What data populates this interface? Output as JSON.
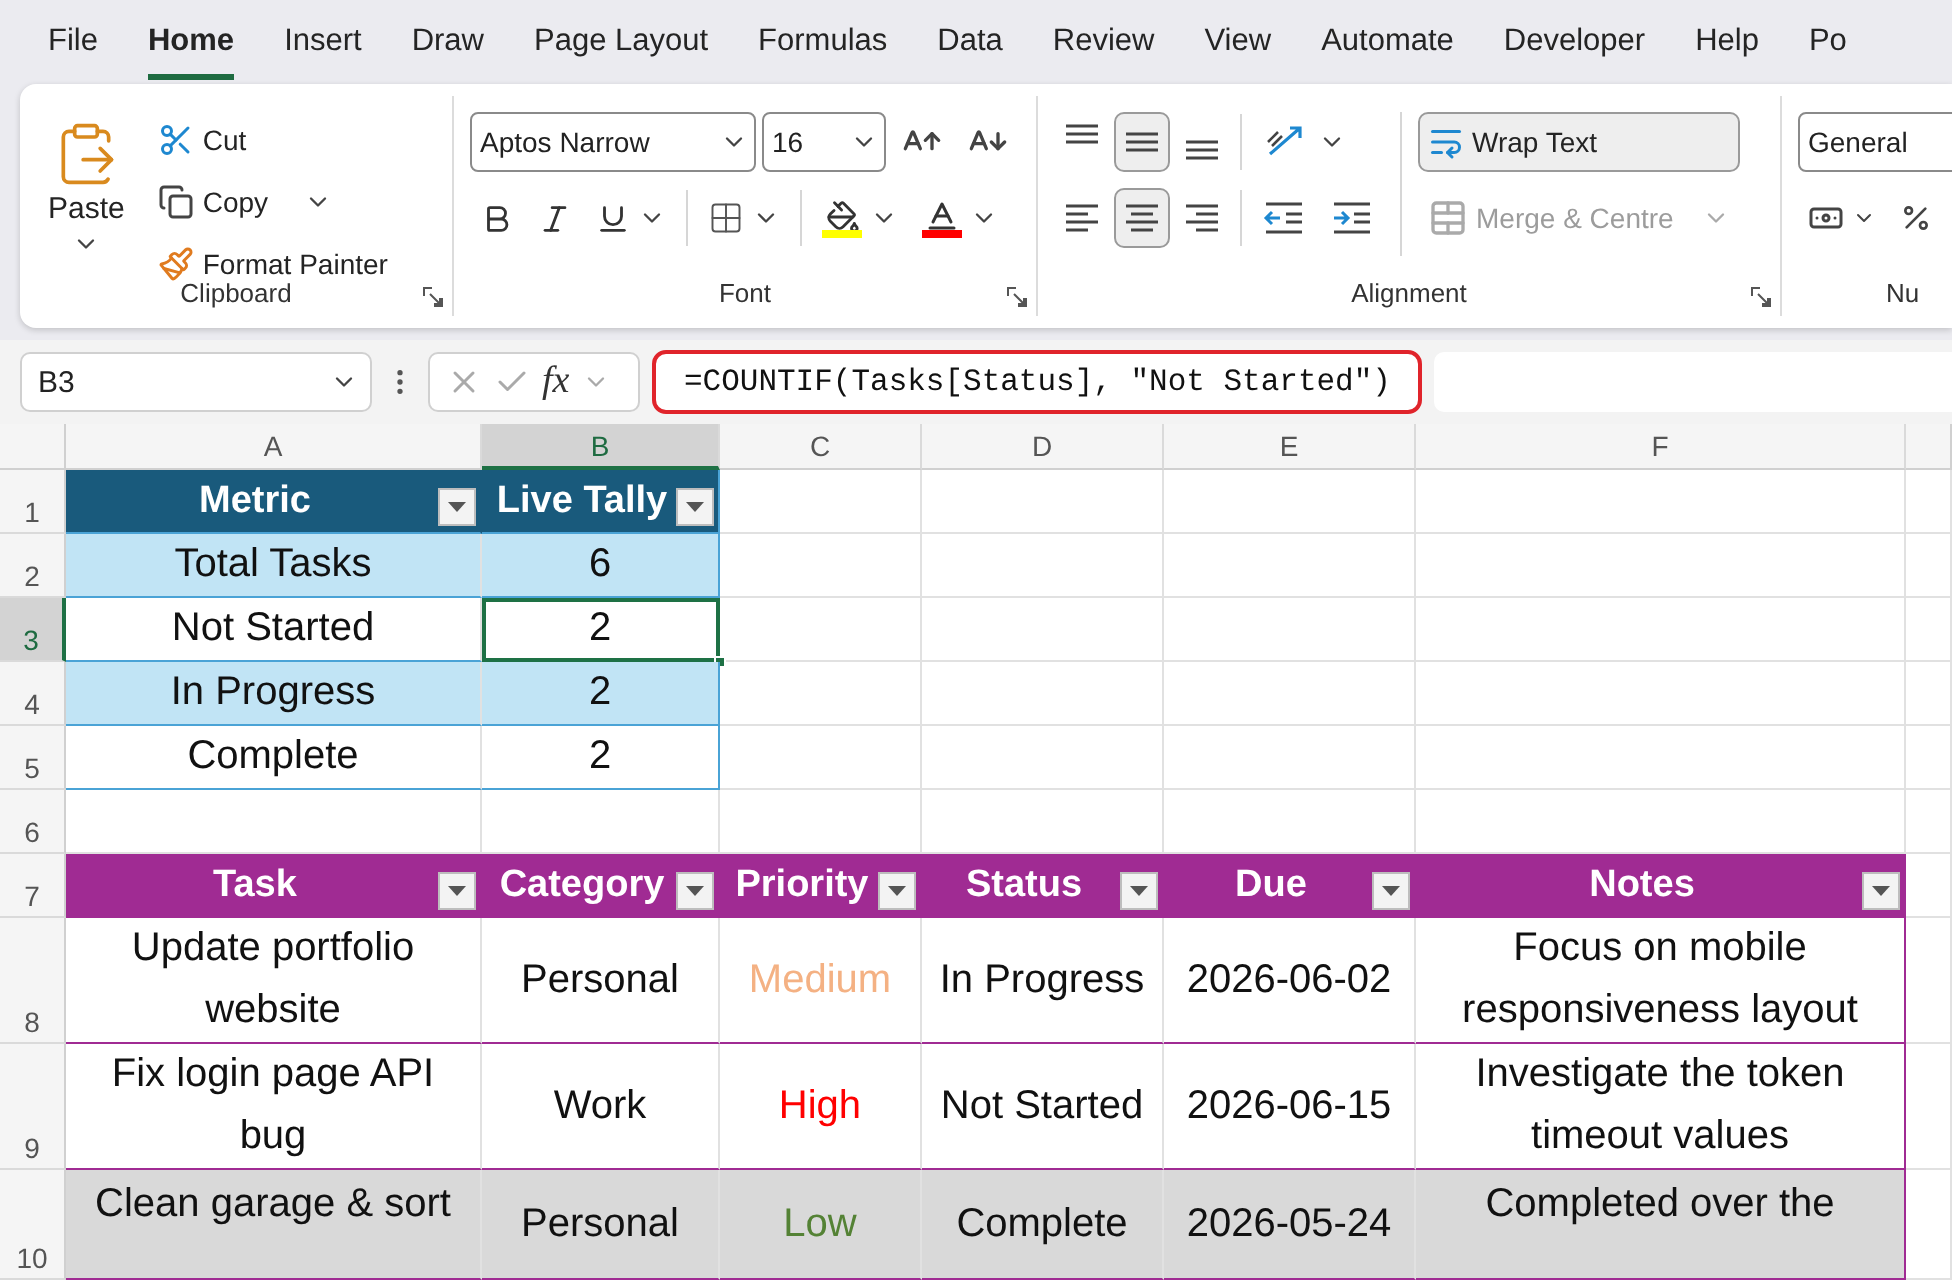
{
  "menu_tabs": [
    {
      "label": "File",
      "selected": false
    },
    {
      "label": "Home",
      "selected": true
    },
    {
      "label": "Insert",
      "selected": false
    },
    {
      "label": "Draw",
      "selected": false
    },
    {
      "label": "Page Layout",
      "selected": false
    },
    {
      "label": "Formulas",
      "selected": false
    },
    {
      "label": "Data",
      "selected": false
    },
    {
      "label": "Review",
      "selected": false
    },
    {
      "label": "View",
      "selected": false
    },
    {
      "label": "Automate",
      "selected": false
    },
    {
      "label": "Developer",
      "selected": false
    },
    {
      "label": "Help",
      "selected": false
    },
    {
      "label": "Po",
      "selected": false
    }
  ],
  "ribbon": {
    "clipboard": {
      "paste": "Paste",
      "cut": "Cut",
      "copy": "Copy",
      "format_painter": "Format Painter",
      "label": "Clipboard"
    },
    "font": {
      "name": "Aptos Narrow",
      "size": "16",
      "label": "Font"
    },
    "alignment": {
      "vertical": [
        {
          "kind": "top",
          "selected": false
        },
        {
          "kind": "middle",
          "selected": true
        },
        {
          "kind": "bottom",
          "selected": false
        }
      ],
      "horizontal": [
        {
          "kind": "left",
          "selected": false
        },
        {
          "kind": "center",
          "selected": true
        },
        {
          "kind": "right",
          "selected": false
        }
      ],
      "wrap_text": {
        "label": "Wrap Text",
        "on": true
      },
      "merge": {
        "label": "Merge & Centre",
        "disabled": true
      },
      "label": "Alignment"
    },
    "number": {
      "format": "General",
      "label": "Nu"
    }
  },
  "formula_bar": {
    "name_box": "B3",
    "fx": "fx",
    "formula": "=COUNTIF(Tasks[Status], \"Not Started\")"
  },
  "sheet": {
    "columns": [
      {
        "label": "A",
        "selected": false
      },
      {
        "label": "B",
        "selected": true
      },
      {
        "label": "C",
        "selected": false
      },
      {
        "label": "D",
        "selected": false
      },
      {
        "label": "E",
        "selected": false
      },
      {
        "label": "F",
        "selected": false
      }
    ],
    "rows": [
      {
        "label": "1",
        "selected": false
      },
      {
        "label": "2",
        "selected": false
      },
      {
        "label": "3",
        "selected": true
      },
      {
        "label": "4",
        "selected": false
      },
      {
        "label": "5",
        "selected": false
      },
      {
        "label": "6",
        "selected": false
      },
      {
        "label": "7",
        "selected": false
      },
      {
        "label": "8",
        "selected": false
      },
      {
        "label": "9",
        "selected": false
      },
      {
        "label": "10",
        "selected": false
      }
    ],
    "summary_table": {
      "columns": [
        "Metric",
        "Live Tally"
      ],
      "rows": [
        {
          "metric": "Total Tasks",
          "tally": "6",
          "selected": false
        },
        {
          "metric": "Not Started",
          "tally": "2",
          "selected": true
        },
        {
          "metric": "In Progress",
          "tally": "2",
          "selected": false
        },
        {
          "metric": "Complete",
          "tally": "2",
          "selected": false
        }
      ]
    },
    "tasks_table": {
      "columns": [
        "Task",
        "Category",
        "Priority",
        "Status",
        "Due",
        "Notes"
      ],
      "rows": [
        {
          "task": "Update portfolio website",
          "category": "Personal",
          "priority": {
            "label": "Medium",
            "color": "#f4b183"
          },
          "status": "In Progress",
          "due": "2026-06-02",
          "notes": "Focus on mobile responsiveness layout",
          "highlighted": false
        },
        {
          "task": "Fix login page API bug",
          "category": "Work",
          "priority": {
            "label": "High",
            "color": "#ff0000"
          },
          "status": "Not Started",
          "due": "2026-06-15",
          "notes": "Investigate the token timeout values",
          "highlighted": false
        },
        {
          "task": "Clean garage & sort",
          "category": "Personal",
          "priority": {
            "label": "Low",
            "color": "#548235"
          },
          "status": "Complete",
          "due": "2026-05-24",
          "notes": "Completed over the",
          "highlighted": true
        }
      ]
    }
  }
}
